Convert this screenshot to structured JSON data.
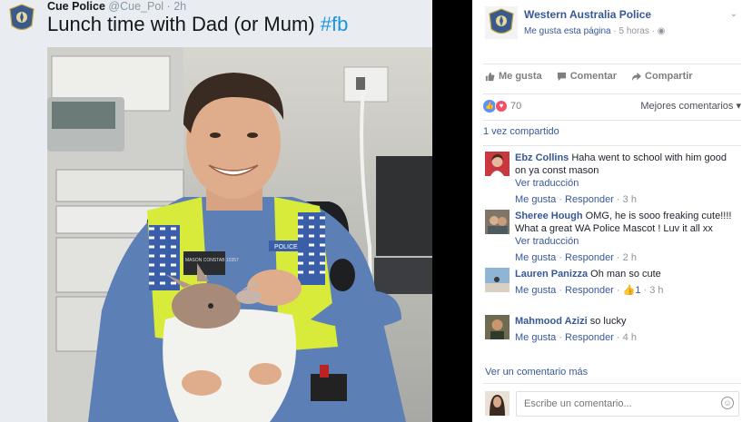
{
  "tweet": {
    "account_name": "Cue Police",
    "handle": "@Cue_Pol",
    "separator": "·",
    "time": "2h",
    "text_main": "Lunch time with Dad (or Mum)",
    "hashtag": "#fb",
    "badge_text": "POLICE",
    "badge_name": "MASON CONSTAB 10357"
  },
  "post": {
    "page_name": "Western Australia Police",
    "meta_like": "Me gusta esta página",
    "meta_dot": " · ",
    "meta_time": "5 horas",
    "meta_sep": " · ",
    "actions": {
      "like": "Me gusta",
      "comment": "Comentar",
      "share": "Compartir"
    },
    "reaction_count": "70",
    "sort_label": "Mejores comentarios",
    "shared": "1 vez compartido",
    "see_more": "Ver un comentario más",
    "write_placeholder": "Escribe un comentario...",
    "colors": {
      "link": "#365899",
      "like": "#5890ff",
      "love": "#f25268"
    }
  },
  "comments": [
    {
      "name": "Ebz Collins",
      "text": "Haha went to school with him good on ya const mason",
      "translate": "Ver traducción",
      "like": "Me gusta",
      "reply": "Responder",
      "time": "3 h",
      "likes": ""
    },
    {
      "name": "Sheree Hough",
      "text": "OMG, he is sooo freaking cute!!!! What a great WA Police Mascot ! Luv it all xx",
      "translate": "Ver traducción",
      "like": "Me gusta",
      "reply": "Responder",
      "time": "2 h",
      "likes": ""
    },
    {
      "name": "Lauren Panizza",
      "text": "Oh man so cute",
      "translate": "",
      "like": "Me gusta",
      "reply": "Responder",
      "time": "3 h",
      "likes": "1"
    },
    {
      "name": "Mahmood Azizi",
      "text": "so lucky",
      "translate": "",
      "like": "Me gusta",
      "reply": "Responder",
      "time": "4 h",
      "likes": ""
    }
  ],
  "separators": {
    "dot": " · "
  }
}
